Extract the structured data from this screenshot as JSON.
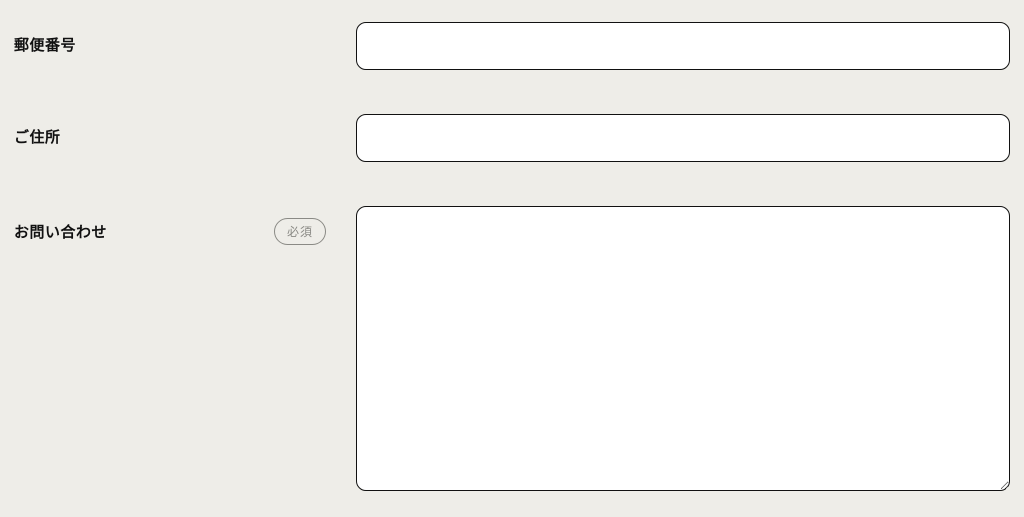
{
  "form": {
    "fields": [
      {
        "label": "郵便番号",
        "required": false,
        "value": ""
      },
      {
        "label": "ご住所",
        "required": false,
        "value": ""
      },
      {
        "label": "お問い合わせ",
        "required": true,
        "value": ""
      }
    ],
    "required_badge_text": "必須"
  }
}
